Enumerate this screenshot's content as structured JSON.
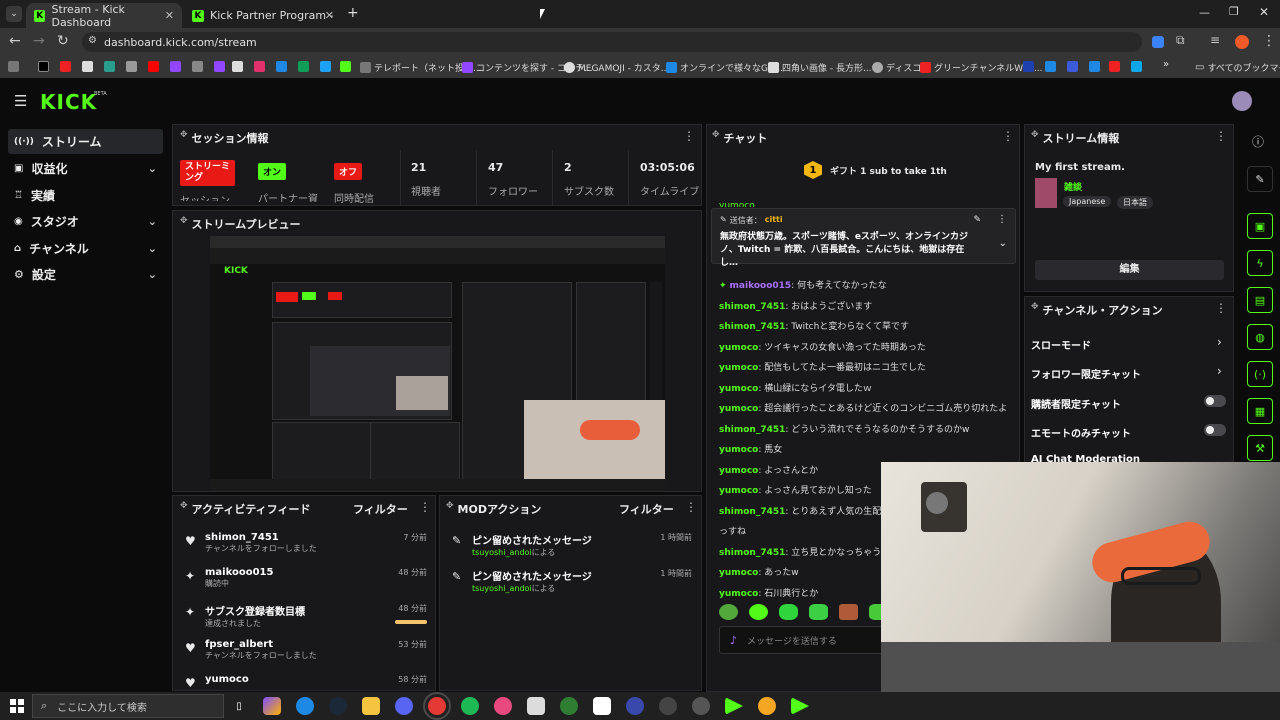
{
  "browser": {
    "tabs": [
      {
        "title": "Stream - Kick Dashboard"
      },
      {
        "title": "Kick Partner Program - Kick Da"
      }
    ],
    "url": "dashboard.kick.com/stream",
    "bookmarks": [
      "テレポート（ネット投票...",
      "コンテンツを探す - コンテ...",
      "MEGAMOJI - カスタ...",
      "オンラインで様々なGIF...",
      "四角い画像 - 長方形...",
      "ディスコ",
      "グリーンチャンネルWeb...",
      "すべてのブックマーク"
    ]
  },
  "app": {
    "logo": "KICK",
    "beta": "BETA"
  },
  "sidebar": {
    "items": [
      {
        "label": "ストリーム",
        "icon": "stream-icon"
      },
      {
        "label": "収益化",
        "icon": "money-icon"
      },
      {
        "label": "実績",
        "icon": "trophy-icon"
      },
      {
        "label": "スタジオ",
        "icon": "studio-icon"
      },
      {
        "label": "チャンネル",
        "icon": "channel-icon"
      },
      {
        "label": "設定",
        "icon": "gear-icon"
      }
    ]
  },
  "session": {
    "title": "セッション情報",
    "stats": [
      {
        "badge": "ストリーミング",
        "label": "セッション"
      },
      {
        "badge": "オン",
        "label": "パートナー資格"
      },
      {
        "badge": "オフ",
        "label": "同時配信"
      },
      {
        "value": "21",
        "label": "視聴者"
      },
      {
        "value": "47",
        "label": "フォロワー"
      },
      {
        "value": "2",
        "label": "サブスク数"
      },
      {
        "value": "03:05:06",
        "label": "タイムライブ"
      }
    ]
  },
  "preview": {
    "title": "ストリームプレビュー"
  },
  "activity": {
    "title": "アクティビティフィード",
    "filter": "フィルター",
    "items": [
      {
        "name": "shimon_7451",
        "sub": "チャンネルをフォローしました",
        "time": "7 分前"
      },
      {
        "name": "maikooo015",
        "sub": "購読中",
        "time": "48 分前"
      },
      {
        "name": "サブスク登録者数目標",
        "sub": "達成されました",
        "time": "48 分前"
      },
      {
        "name": "fpser_albert",
        "sub": "チャンネルをフォローしました",
        "time": "53 分前"
      },
      {
        "name": "yumoco",
        "sub": "",
        "time": "58 分前"
      }
    ]
  },
  "mod": {
    "title": "MODアクション",
    "filter": "フィルター",
    "items": [
      {
        "name": "ピン留めされたメッセージ",
        "user": "tsuyoshi_andoi",
        "suffix": "による",
        "time": "1 時間前"
      },
      {
        "name": "ピン留めされたメッセージ",
        "user": "tsuyoshi_andoi",
        "suffix": "による",
        "time": "1 時間前"
      }
    ]
  },
  "chat": {
    "title": "チャット",
    "gift": "ギフト 1 sub to take 1th",
    "gift_count": "1",
    "pinned_label": "送信者：",
    "pinned_user": "citti",
    "pinned_text": "無政府状態万歳。スポーツ賭博、eスポーツ、オンラインカジノ、Twitch = 詐欺、八百長試合。こんにちは、地獄は存在し…",
    "messages": [
      {
        "user": "maikooo015",
        "text": "何も考えてなかったな",
        "color": "#a970ff"
      },
      {
        "user": "shimon_7451",
        "text": "おはようございます",
        "color": "#53fc18"
      },
      {
        "user": "shimon_7451",
        "text": "Twitchと変わらなくて草です",
        "color": "#53fc18"
      },
      {
        "user": "yumoco",
        "text": "ツイキャスの女食い漁ってた時期あった",
        "color": "#53fc18"
      },
      {
        "user": "yumoco",
        "text": "配信もしてたよ一番最初はニコ生でした",
        "color": "#53fc18"
      },
      {
        "user": "yumoco",
        "text": "横山緑にならイタ電したｗ",
        "color": "#53fc18"
      },
      {
        "user": "yumoco",
        "text": "超会議行ったことあるけど近くのコンビニゴム売り切れたよ",
        "color": "#53fc18"
      },
      {
        "user": "shimon_7451",
        "text": "どういう流れでそうなるのかそうするのかw",
        "color": "#53fc18"
      },
      {
        "user": "yumoco",
        "text": "馬女",
        "color": "#53fc18"
      },
      {
        "user": "yumoco",
        "text": "よっさんとか",
        "color": "#53fc18"
      },
      {
        "user": "yumoco",
        "text": "よっさん見ておかし知った",
        "color": "#53fc18"
      },
      {
        "user": "shimon_7451",
        "text": "とりあえず人気の生配信は",
        "color": "#53fc18"
      },
      {
        "user": "",
        "text": "っすね",
        "color": "#53fc18"
      },
      {
        "user": "shimon_7451",
        "text": "立ち見とかなっちゃうから",
        "color": "#53fc18"
      },
      {
        "user": "yumoco",
        "text": "あったw",
        "color": "#53fc18"
      },
      {
        "user": "yumoco",
        "text": "石川典行とか",
        "color": "#53fc18"
      }
    ],
    "input_placeholder": "メッセージを送信する"
  },
  "stream_info": {
    "title": "ストリーム情報",
    "stream_title": "My first stream.",
    "category": "雑談",
    "tags": [
      "Japanese",
      "日本語"
    ],
    "edit": "編集"
  },
  "channel_actions": {
    "title": "チャンネル・アクション",
    "items": [
      {
        "label": "スローモード",
        "type": "arrow"
      },
      {
        "label": "フォロワー限定チャット",
        "type": "arrow"
      },
      {
        "label": "購読者限定チャット",
        "type": "toggle"
      },
      {
        "label": "エモートのみチャット",
        "type": "toggle"
      },
      {
        "label": "AI Chat Moderation",
        "type": "link"
      }
    ]
  },
  "taskbar": {
    "search_placeholder": "ここに入力して検索"
  },
  "colors": {
    "accent": "#53fc18",
    "live": "#e91916",
    "panel": "#18181b"
  }
}
